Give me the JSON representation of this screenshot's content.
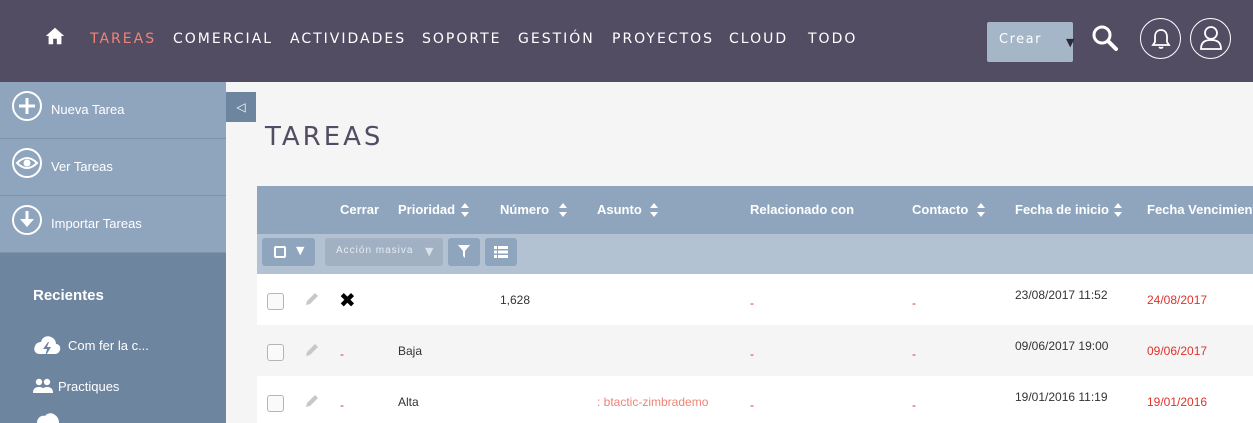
{
  "nav": {
    "items": [
      "Tareas",
      "Comercial",
      "Actividades",
      "Soporte",
      "Gestión",
      "Proyectos",
      "Cloud",
      "Todo"
    ],
    "active": "Tareas",
    "crear_label": "Crear",
    "icons": [
      "home-icon",
      "search-icon",
      "bell-icon",
      "user-icon"
    ]
  },
  "sidebar": {
    "actions": [
      {
        "label": "Nueva Tarea",
        "icon": "plus-circle-icon"
      },
      {
        "label": "Ver Tareas",
        "icon": "eye-icon"
      },
      {
        "label": "Importar Tareas",
        "icon": "download-icon"
      }
    ],
    "recent_heading": "Recientes",
    "recent": [
      {
        "label": "Com fer la c...",
        "icon": "lightning-cloud-icon"
      },
      {
        "label": "Practiques",
        "icon": "people-icon"
      }
    ],
    "toggle": "◁"
  },
  "page": {
    "title": "TAREAS"
  },
  "table": {
    "columns": [
      "Cerrar",
      "Prioridad",
      "Número",
      "Asunto",
      "Relacionado con",
      "Contacto",
      "Fecha de inicio",
      "Fecha Vencimiento"
    ],
    "bulk_action_label": "Acción masiva",
    "rows": [
      {
        "cerrar": "✖",
        "prioridad": "",
        "numero": "1,628",
        "asunto": "",
        "relacionado": "-",
        "contacto": "-",
        "inicio": "23/08/2017 11:52",
        "vencimiento": "24/08/2017"
      },
      {
        "cerrar": "-",
        "prioridad": "Baja",
        "numero": "",
        "asunto": "",
        "relacionado": "-",
        "contacto": "-",
        "inicio": "09/06/2017 19:00",
        "vencimiento": "09/06/2017"
      },
      {
        "cerrar": "-",
        "prioridad": "Alta",
        "numero": "",
        "asunto": ": btactic-zimbrademo",
        "relacionado": "-",
        "contacto": "-",
        "inicio": "19/01/2016 11:19",
        "vencimiento": "19/01/2016"
      }
    ]
  },
  "colors": {
    "nav_bg": "#534d64",
    "active": "#f08377",
    "sidebar_bg": "#6e85a0",
    "header_bg": "#8ea5bd",
    "due_red": "#e0322b"
  }
}
